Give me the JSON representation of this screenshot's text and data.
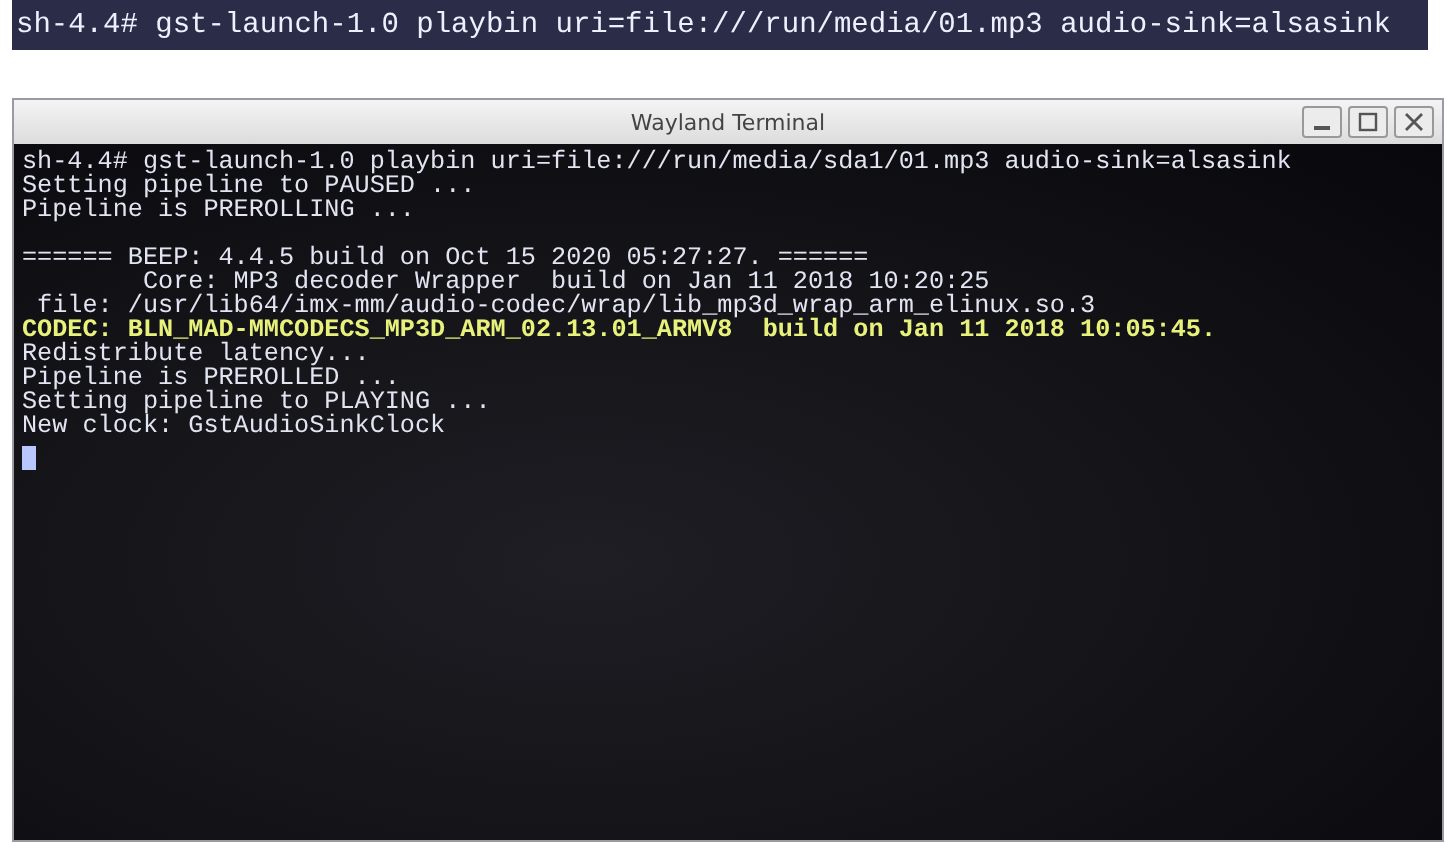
{
  "command_strip": {
    "text": "sh-4.4# gst-launch-1.0 playbin uri=file:///run/media/01.mp3 audio-sink=alsasink"
  },
  "window": {
    "title": "Wayland Terminal"
  },
  "terminal": {
    "lines": [
      {
        "kind": "normal",
        "text": "sh-4.4# gst-launch-1.0 playbin uri=file:///run/media/sda1/01.mp3 audio-sink=alsasink"
      },
      {
        "kind": "normal",
        "text": "Setting pipeline to PAUSED ..."
      },
      {
        "kind": "normal",
        "text": "Pipeline is PREROLLING ..."
      },
      {
        "kind": "blank"
      },
      {
        "kind": "normal",
        "text": "====== BEEP: 4.4.5 build on Oct 15 2020 05:27:27. ======"
      },
      {
        "kind": "normal",
        "text": "        Core: MP3 decoder Wrapper  build on Jan 11 2018 10:20:25"
      },
      {
        "kind": "normal",
        "text": " file: /usr/lib64/imx-mm/audio-codec/wrap/lib_mp3d_wrap_arm_elinux.so.3"
      },
      {
        "kind": "highlight",
        "text": "CODEC: BLN_MAD-MMCODECS_MP3D_ARM_02.13.01_ARMV8  build on Jan 11 2018 10:05:45."
      },
      {
        "kind": "normal",
        "text": "Redistribute latency..."
      },
      {
        "kind": "normal",
        "text": "Pipeline is PREROLLED ..."
      },
      {
        "kind": "normal",
        "text": "Setting pipeline to PLAYING ..."
      },
      {
        "kind": "normal",
        "text": "New clock: GstAudioSinkClock"
      }
    ]
  }
}
